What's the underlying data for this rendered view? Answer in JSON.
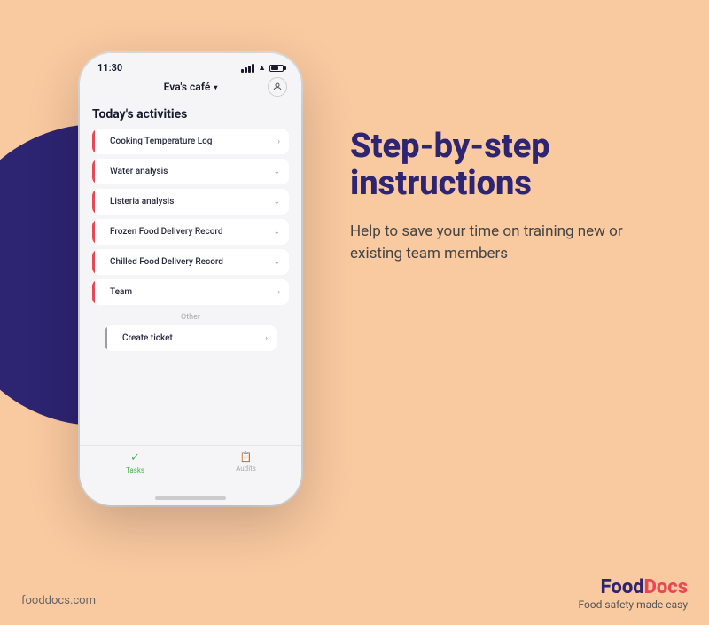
{
  "background_color": "#F9C9A0",
  "phone": {
    "time": "11:30",
    "cafe_name": "Eva's café",
    "profile_icon": "👤",
    "section_title": "Today's activities",
    "activities": [
      {
        "label": "Cooking Temperature Log",
        "chevron": "›",
        "accent": "red"
      },
      {
        "label": "Water analysis",
        "chevron": "⌄",
        "accent": "red"
      },
      {
        "label": "Listeria analysis",
        "chevron": "⌄",
        "accent": "red"
      },
      {
        "label": "Frozen Food Delivery Record",
        "chevron": "⌄",
        "accent": "red"
      },
      {
        "label": "Chilled Food Delivery Record",
        "chevron": "⌄",
        "accent": "red"
      },
      {
        "label": "Team",
        "chevron": "›",
        "accent": "red"
      }
    ],
    "other_label": "Other",
    "other_activities": [
      {
        "label": "Create ticket",
        "chevron": "›",
        "accent": "gray"
      }
    ],
    "tabs": [
      {
        "label": "Tasks",
        "active": true
      },
      {
        "label": "Audits",
        "active": false
      }
    ]
  },
  "headline": "Step-by-step instructions",
  "description": "Help to save your time on training new or existing team members",
  "footer": {
    "website": "fooddocs.com",
    "brand_name": "FoodDocs",
    "tagline": "Food safety made easy"
  }
}
